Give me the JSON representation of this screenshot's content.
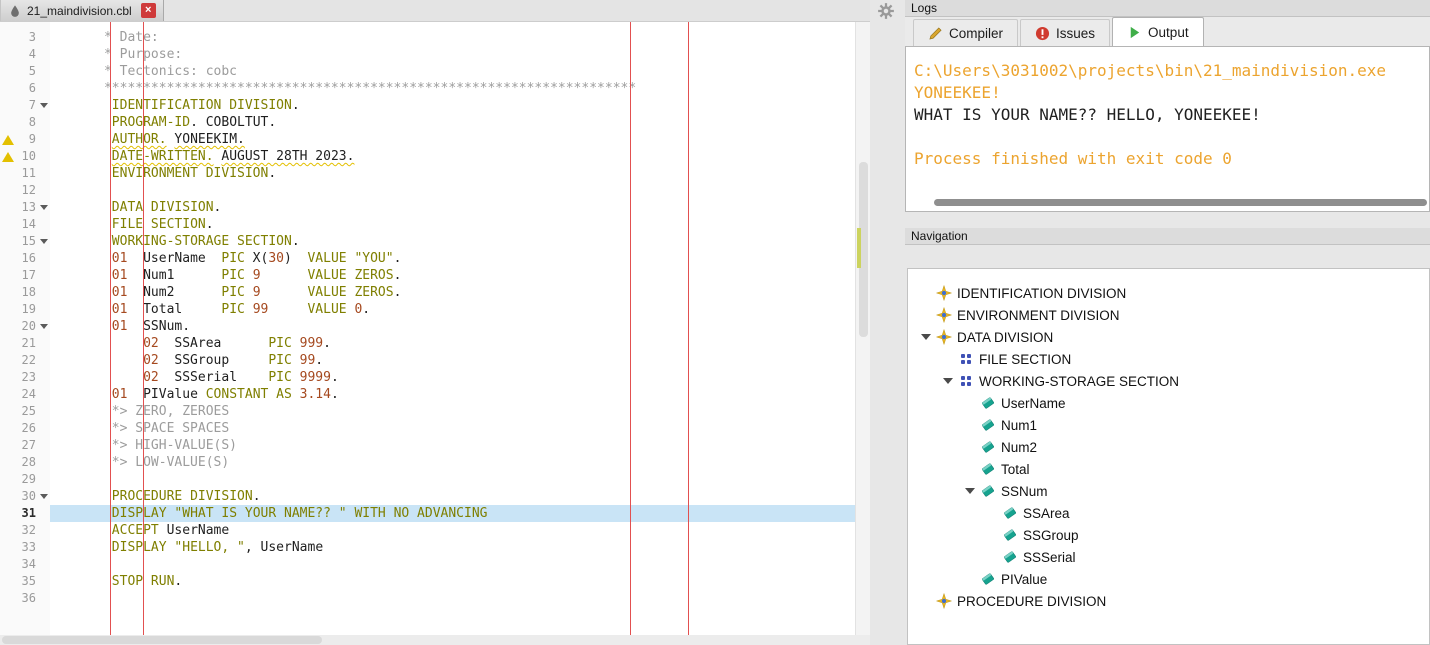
{
  "colors": {
    "keyword": "#7f7f00",
    "string": "#7f7f00",
    "number": "#a5491f",
    "comment": "#9c9c9c",
    "text": "#1f1f1f",
    "line_number": "#9a9a9a",
    "terminal_orange": "#eca42f",
    "terminal_black": "#1f1f1f",
    "line_highlight": "#c9e4f6",
    "margin_line": "#e25050",
    "warning": "#e3c000",
    "close_red": "#cf3a3a"
  },
  "editor": {
    "tab": {
      "title": "21_maindivision.cbl",
      "close_glyph": "×",
      "icon": "file-icon"
    },
    "lines": [
      {
        "n": 3,
        "tokens": [
          {
            "c": "com",
            "t": "      * Date:"
          }
        ]
      },
      {
        "n": 4,
        "tokens": [
          {
            "c": "com",
            "t": "      * Purpose:"
          }
        ]
      },
      {
        "n": 5,
        "tokens": [
          {
            "c": "com",
            "t": "      * Tectonics: cobc"
          }
        ]
      },
      {
        "n": 6,
        "tokens": [
          {
            "c": "com",
            "t": "      ********************************************************************"
          }
        ]
      },
      {
        "n": 7,
        "fold": true,
        "tokens": [
          {
            "c": "sp",
            "t": "       "
          },
          {
            "c": "kw",
            "t": "IDENTIFICATION DIVISION"
          },
          {
            "c": "txt",
            "t": "."
          }
        ]
      },
      {
        "n": 8,
        "tokens": [
          {
            "c": "sp",
            "t": "       "
          },
          {
            "c": "kw",
            "t": "PROGRAM-ID"
          },
          {
            "c": "txt",
            "t": ". COBOLTUT."
          }
        ]
      },
      {
        "n": 9,
        "warn": true,
        "tokens": [
          {
            "c": "sp",
            "t": "       "
          },
          {
            "c": "kw",
            "t": "AUTHOR.",
            "u": true
          },
          {
            "c": "sp",
            "t": " "
          },
          {
            "c": "txt",
            "t": "YONEEKIM.",
            "u": true
          }
        ]
      },
      {
        "n": 10,
        "warn": true,
        "tokens": [
          {
            "c": "sp",
            "t": "       "
          },
          {
            "c": "kw",
            "t": "DATE-WRITTEN.",
            "u": true
          },
          {
            "c": "sp",
            "t": " "
          },
          {
            "c": "txt",
            "t": "AUGUST 28TH 2023.",
            "u": true
          }
        ]
      },
      {
        "n": 11,
        "tokens": [
          {
            "c": "sp",
            "t": "       "
          },
          {
            "c": "kw",
            "t": "ENVIRONMENT DIVISION"
          },
          {
            "c": "txt",
            "t": "."
          }
        ]
      },
      {
        "n": 12,
        "tokens": []
      },
      {
        "n": 13,
        "fold": true,
        "tokens": [
          {
            "c": "sp",
            "t": "       "
          },
          {
            "c": "kw",
            "t": "DATA DIVISION"
          },
          {
            "c": "txt",
            "t": "."
          }
        ]
      },
      {
        "n": 14,
        "tokens": [
          {
            "c": "sp",
            "t": "       "
          },
          {
            "c": "kw",
            "t": "FILE SECTION"
          },
          {
            "c": "txt",
            "t": "."
          }
        ]
      },
      {
        "n": 15,
        "fold": true,
        "tokens": [
          {
            "c": "sp",
            "t": "       "
          },
          {
            "c": "kw",
            "t": "WORKING-STORAGE SECTION"
          },
          {
            "c": "txt",
            "t": "."
          }
        ]
      },
      {
        "n": 16,
        "tokens": [
          {
            "c": "sp",
            "t": "       "
          },
          {
            "c": "num",
            "t": "01"
          },
          {
            "c": "txt",
            "t": "  UserName  "
          },
          {
            "c": "kw",
            "t": "PIC"
          },
          {
            "c": "txt",
            "t": " X("
          },
          {
            "c": "num",
            "t": "30"
          },
          {
            "c": "txt",
            "t": ")  "
          },
          {
            "c": "kw",
            "t": "VALUE"
          },
          {
            "c": "txt",
            "t": " "
          },
          {
            "c": "str",
            "t": "\"YOU\""
          },
          {
            "c": "txt",
            "t": "."
          }
        ]
      },
      {
        "n": 17,
        "tokens": [
          {
            "c": "sp",
            "t": "       "
          },
          {
            "c": "num",
            "t": "01"
          },
          {
            "c": "txt",
            "t": "  Num1      "
          },
          {
            "c": "kw",
            "t": "PIC"
          },
          {
            "c": "txt",
            "t": " "
          },
          {
            "c": "num",
            "t": "9"
          },
          {
            "c": "txt",
            "t": "      "
          },
          {
            "c": "kw",
            "t": "VALUE"
          },
          {
            "c": "txt",
            "t": " "
          },
          {
            "c": "kw",
            "t": "ZEROS"
          },
          {
            "c": "txt",
            "t": "."
          }
        ]
      },
      {
        "n": 18,
        "tokens": [
          {
            "c": "sp",
            "t": "       "
          },
          {
            "c": "num",
            "t": "01"
          },
          {
            "c": "txt",
            "t": "  Num2      "
          },
          {
            "c": "kw",
            "t": "PIC"
          },
          {
            "c": "txt",
            "t": " "
          },
          {
            "c": "num",
            "t": "9"
          },
          {
            "c": "txt",
            "t": "      "
          },
          {
            "c": "kw",
            "t": "VALUE"
          },
          {
            "c": "txt",
            "t": " "
          },
          {
            "c": "kw",
            "t": "ZEROS"
          },
          {
            "c": "txt",
            "t": "."
          }
        ]
      },
      {
        "n": 19,
        "tokens": [
          {
            "c": "sp",
            "t": "       "
          },
          {
            "c": "num",
            "t": "01"
          },
          {
            "c": "txt",
            "t": "  Total     "
          },
          {
            "c": "kw",
            "t": "PIC"
          },
          {
            "c": "txt",
            "t": " "
          },
          {
            "c": "num",
            "t": "99"
          },
          {
            "c": "txt",
            "t": "     "
          },
          {
            "c": "kw",
            "t": "VALUE"
          },
          {
            "c": "txt",
            "t": " "
          },
          {
            "c": "num",
            "t": "0"
          },
          {
            "c": "txt",
            "t": "."
          }
        ]
      },
      {
        "n": 20,
        "fold": true,
        "tokens": [
          {
            "c": "sp",
            "t": "       "
          },
          {
            "c": "num",
            "t": "01"
          },
          {
            "c": "txt",
            "t": "  SSNum."
          }
        ]
      },
      {
        "n": 21,
        "tokens": [
          {
            "c": "sp",
            "t": "           "
          },
          {
            "c": "num",
            "t": "02"
          },
          {
            "c": "txt",
            "t": "  SSArea      "
          },
          {
            "c": "kw",
            "t": "PIC"
          },
          {
            "c": "txt",
            "t": " "
          },
          {
            "c": "num",
            "t": "999"
          },
          {
            "c": "txt",
            "t": "."
          }
        ]
      },
      {
        "n": 22,
        "tokens": [
          {
            "c": "sp",
            "t": "           "
          },
          {
            "c": "num",
            "t": "02"
          },
          {
            "c": "txt",
            "t": "  SSGroup     "
          },
          {
            "c": "kw",
            "t": "PIC"
          },
          {
            "c": "txt",
            "t": " "
          },
          {
            "c": "num",
            "t": "99"
          },
          {
            "c": "txt",
            "t": "."
          }
        ]
      },
      {
        "n": 23,
        "tokens": [
          {
            "c": "sp",
            "t": "           "
          },
          {
            "c": "num",
            "t": "02"
          },
          {
            "c": "txt",
            "t": "  SSSerial    "
          },
          {
            "c": "kw",
            "t": "PIC"
          },
          {
            "c": "txt",
            "t": " "
          },
          {
            "c": "num",
            "t": "9999"
          },
          {
            "c": "txt",
            "t": "."
          }
        ]
      },
      {
        "n": 24,
        "tokens": [
          {
            "c": "sp",
            "t": "       "
          },
          {
            "c": "num",
            "t": "01"
          },
          {
            "c": "txt",
            "t": "  PIValue "
          },
          {
            "c": "kw",
            "t": "CONSTANT AS"
          },
          {
            "c": "txt",
            "t": " "
          },
          {
            "c": "num",
            "t": "3.14"
          },
          {
            "c": "txt",
            "t": "."
          }
        ]
      },
      {
        "n": 25,
        "tokens": [
          {
            "c": "com",
            "t": "       *> ZERO, ZEROES"
          }
        ]
      },
      {
        "n": 26,
        "tokens": [
          {
            "c": "com",
            "t": "       *> SPACE SPACES"
          }
        ]
      },
      {
        "n": 27,
        "tokens": [
          {
            "c": "com",
            "t": "       *> HIGH-VALUE(S)"
          }
        ]
      },
      {
        "n": 28,
        "tokens": [
          {
            "c": "com",
            "t": "       *> LOW-VALUE(S)"
          }
        ]
      },
      {
        "n": 29,
        "tokens": []
      },
      {
        "n": 30,
        "fold": true,
        "tokens": [
          {
            "c": "sp",
            "t": "       "
          },
          {
            "c": "kw",
            "t": "PROCEDURE DIVISION"
          },
          {
            "c": "txt",
            "t": "."
          }
        ]
      },
      {
        "n": 31,
        "hl": true,
        "tokens": [
          {
            "c": "sp",
            "t": "       "
          },
          {
            "c": "kw",
            "t": "DISPLAY"
          },
          {
            "c": "txt",
            "t": " "
          },
          {
            "c": "str",
            "t": "\"WHAT IS YOUR NAME?? \""
          },
          {
            "c": "txt",
            "t": " "
          },
          {
            "c": "kw",
            "t": "WITH NO ADVANCING"
          }
        ]
      },
      {
        "n": 32,
        "tokens": [
          {
            "c": "sp",
            "t": "       "
          },
          {
            "c": "kw",
            "t": "ACCEPT"
          },
          {
            "c": "txt",
            "t": " UserName"
          }
        ]
      },
      {
        "n": 33,
        "tokens": [
          {
            "c": "sp",
            "t": "       "
          },
          {
            "c": "kw",
            "t": "DISPLAY"
          },
          {
            "c": "txt",
            "t": " "
          },
          {
            "c": "str",
            "t": "\"HELLO, \""
          },
          {
            "c": "txt",
            "t": ", UserName"
          }
        ]
      },
      {
        "n": 34,
        "tokens": []
      },
      {
        "n": 35,
        "tokens": [
          {
            "c": "sp",
            "t": "       "
          },
          {
            "c": "kw",
            "t": "STOP RUN"
          },
          {
            "c": "txt",
            "t": "."
          }
        ]
      },
      {
        "n": 36,
        "tokens": []
      }
    ]
  },
  "logs": {
    "title": "Logs",
    "tabs": [
      {
        "label": "Compiler",
        "icon": "pencil-icon",
        "active": false
      },
      {
        "label": "Issues",
        "icon": "issues-icon",
        "active": false
      },
      {
        "label": "Output",
        "icon": "run-icon",
        "active": true
      }
    ],
    "output_lines": [
      {
        "text": "C:\\Users\\3031002\\projects\\bin\\21_maindivision.exe",
        "color": "orange"
      },
      {
        "text": "YONEEKEE!",
        "color": "orange"
      },
      {
        "text": "WHAT IS YOUR NAME?? HELLO, YONEEKEE!",
        "color": "black"
      },
      {
        "text": "",
        "color": "black"
      },
      {
        "text": "Process finished with exit code 0",
        "color": "orange"
      }
    ]
  },
  "navigation": {
    "title": "Navigation",
    "items": [
      {
        "label": "IDENTIFICATION DIVISION",
        "icon": "division-icon",
        "depth": 1
      },
      {
        "label": "ENVIRONMENT DIVISION",
        "icon": "division-icon",
        "depth": 1
      },
      {
        "label": "DATA DIVISION",
        "icon": "division-icon",
        "depth": 1,
        "expanded": true
      },
      {
        "label": "FILE SECTION",
        "icon": "section-icon",
        "depth": 2
      },
      {
        "label": "WORKING-STORAGE SECTION",
        "icon": "section-icon",
        "depth": 2,
        "expanded": true
      },
      {
        "label": "UserName",
        "icon": "variable-icon",
        "depth": 3
      },
      {
        "label": "Num1",
        "icon": "variable-icon",
        "depth": 3
      },
      {
        "label": "Num2",
        "icon": "variable-icon",
        "depth": 3
      },
      {
        "label": "Total",
        "icon": "variable-icon",
        "depth": 3
      },
      {
        "label": "SSNum",
        "icon": "variable-icon",
        "depth": 3,
        "expanded": true
      },
      {
        "label": "SSArea",
        "icon": "variable-icon",
        "depth": 4
      },
      {
        "label": "SSGroup",
        "icon": "variable-icon",
        "depth": 4
      },
      {
        "label": "SSSerial",
        "icon": "variable-icon",
        "depth": 4
      },
      {
        "label": "PIValue",
        "icon": "variable-icon",
        "depth": 3
      },
      {
        "label": "PROCEDURE DIVISION",
        "icon": "division-icon",
        "depth": 1
      }
    ]
  }
}
